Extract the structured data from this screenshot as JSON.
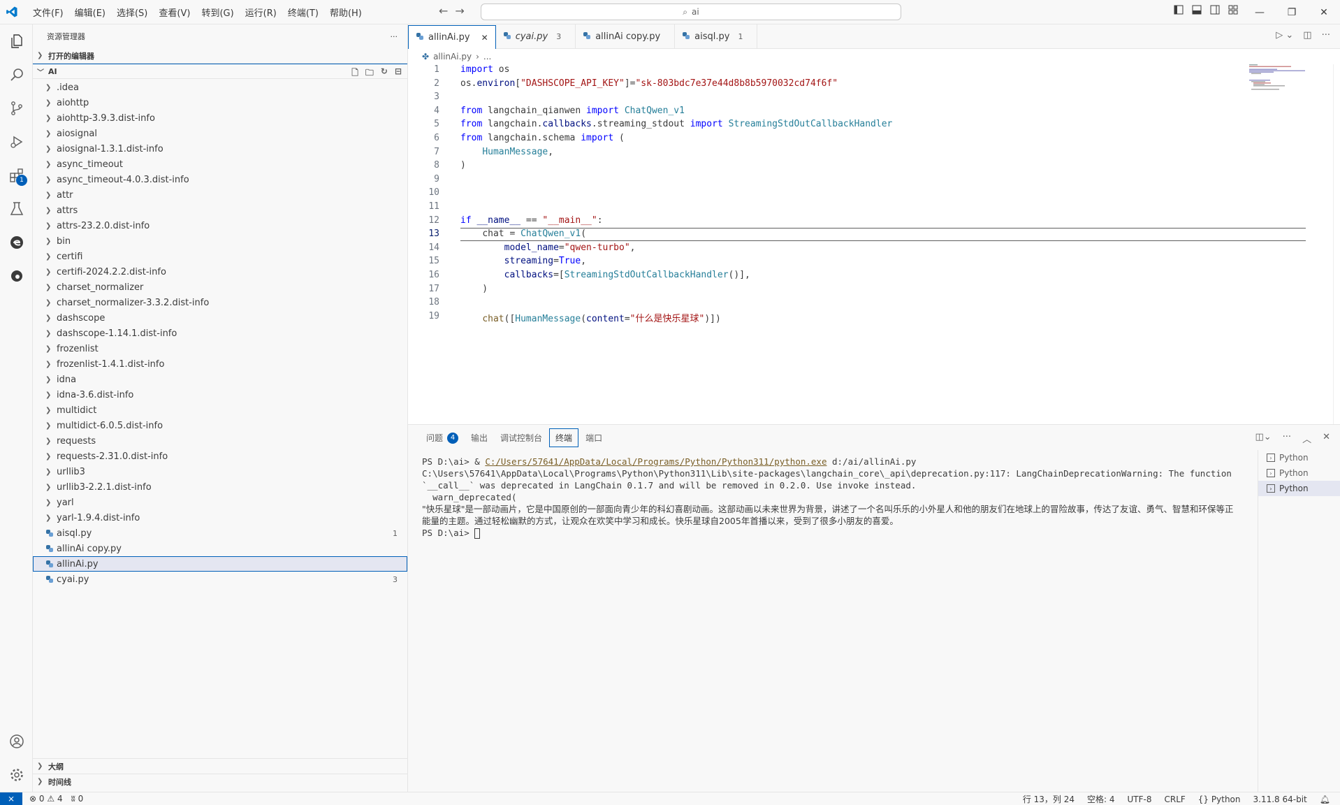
{
  "titlebar": {
    "menu": [
      "文件(F)",
      "编辑(E)",
      "选择(S)",
      "查看(V)",
      "转到(G)",
      "运行(R)",
      "终端(T)",
      "帮助(H)"
    ],
    "search_text": "ai",
    "accent": "#005fb8"
  },
  "sidebar": {
    "header": "资源管理器",
    "more": "···",
    "open_editors": "打开的编辑器",
    "folder": "AI",
    "items": [
      {
        "label": ".idea",
        "type": "folder"
      },
      {
        "label": "aiohttp",
        "type": "folder"
      },
      {
        "label": "aiohttp-3.9.3.dist-info",
        "type": "folder"
      },
      {
        "label": "aiosignal",
        "type": "folder"
      },
      {
        "label": "aiosignal-1.3.1.dist-info",
        "type": "folder"
      },
      {
        "label": "async_timeout",
        "type": "folder"
      },
      {
        "label": "async_timeout-4.0.3.dist-info",
        "type": "folder"
      },
      {
        "label": "attr",
        "type": "folder"
      },
      {
        "label": "attrs",
        "type": "folder"
      },
      {
        "label": "attrs-23.2.0.dist-info",
        "type": "folder"
      },
      {
        "label": "bin",
        "type": "folder"
      },
      {
        "label": "certifi",
        "type": "folder"
      },
      {
        "label": "certifi-2024.2.2.dist-info",
        "type": "folder"
      },
      {
        "label": "charset_normalizer",
        "type": "folder"
      },
      {
        "label": "charset_normalizer-3.3.2.dist-info",
        "type": "folder"
      },
      {
        "label": "dashscope",
        "type": "folder"
      },
      {
        "label": "dashscope-1.14.1.dist-info",
        "type": "folder"
      },
      {
        "label": "frozenlist",
        "type": "folder"
      },
      {
        "label": "frozenlist-1.4.1.dist-info",
        "type": "folder"
      },
      {
        "label": "idna",
        "type": "folder"
      },
      {
        "label": "idna-3.6.dist-info",
        "type": "folder"
      },
      {
        "label": "multidict",
        "type": "folder"
      },
      {
        "label": "multidict-6.0.5.dist-info",
        "type": "folder"
      },
      {
        "label": "requests",
        "type": "folder"
      },
      {
        "label": "requests-2.31.0.dist-info",
        "type": "folder"
      },
      {
        "label": "urllib3",
        "type": "folder"
      },
      {
        "label": "urllib3-2.2.1.dist-info",
        "type": "folder"
      },
      {
        "label": "yarl",
        "type": "folder"
      },
      {
        "label": "yarl-1.9.4.dist-info",
        "type": "folder"
      },
      {
        "label": "aisql.py",
        "type": "file",
        "count": "1"
      },
      {
        "label": "allinAi copy.py",
        "type": "file",
        "count": ""
      },
      {
        "label": "allinAi.py",
        "type": "file",
        "count": "",
        "selected": true
      },
      {
        "label": "cyai.py",
        "type": "file",
        "count": "3"
      }
    ],
    "outline": "大纲",
    "timeline": "时间线"
  },
  "tabs": [
    {
      "label": "allinAi.py",
      "num": "",
      "active": true,
      "italic": false
    },
    {
      "label": "cyai.py",
      "num": "3",
      "active": false,
      "italic": true
    },
    {
      "label": "allinAi copy.py",
      "num": "",
      "active": false,
      "italic": false
    },
    {
      "label": "aisql.py",
      "num": "1",
      "active": false,
      "italic": false
    }
  ],
  "breadcrumb": {
    "file": "allinAi.py",
    "rest": "..."
  },
  "code": {
    "lines": [
      "import os",
      "os.environ[\"DASHSCOPE_API_KEY\"]=\"sk-803bdc7e37e44d8b8b5970032cd74f6f\"",
      "",
      "from langchain_qianwen import ChatQwen_v1",
      "from langchain.callbacks.streaming_stdout import StreamingStdOutCallbackHandler",
      "from langchain.schema import (",
      "    HumanMessage,",
      ")",
      "",
      "",
      "",
      "if __name__ == \"__main__\":",
      "    chat = ChatQwen_v1(",
      "        model_name=\"qwen-turbo\",",
      "        streaming=True,",
      "        callbacks=[StreamingStdOutCallbackHandler()],",
      "    )",
      "",
      "    chat([HumanMessage(content=\"什么是快乐星球\")])"
    ],
    "current_line": 13
  },
  "panel": {
    "tabs": [
      {
        "label": "问题",
        "badge": "4",
        "active": false
      },
      {
        "label": "输出",
        "badge": "",
        "active": false
      },
      {
        "label": "调试控制台",
        "badge": "",
        "active": false
      },
      {
        "label": "终端",
        "badge": "",
        "active": true
      },
      {
        "label": "端口",
        "badge": "",
        "active": false
      }
    ],
    "terminal": {
      "prompt1": "PS D:\\ai> & ",
      "exe_path": "C:/Users/57641/AppData/Local/Programs/Python/Python311/python.exe",
      "script": " d:/ai/allinAi.py",
      "warning": "C:\\Users\\57641\\AppData\\Local\\Programs\\Python\\Python311\\Lib\\site-packages\\langchain_core\\_api\\deprecation.py:117: LangChainDeprecationWarning: The function `__call__` was deprecated in LangChain 0.1.7 and will be removed in 0.2.0. Use invoke instead.",
      "warn_call": "  warn_deprecated(",
      "answer": "\"快乐星球\"是一部动画片，它是中国原创的一部面向青少年的科幻喜剧动画。这部动画以未来世界为背景，讲述了一个名叫乐乐的小外星人和他的朋友们在地球上的冒险故事，传达了友谊、勇气、智慧和环保等正能量的主题。通过轻松幽默的方式，让观众在欢笑中学习和成长。快乐星球自2005年首播以来，受到了很多小朋友的喜爱。",
      "prompt2": "PS D:\\ai> "
    },
    "terminal_list": [
      "Python",
      "Python",
      "Python"
    ]
  },
  "statusbar": {
    "errors": "0",
    "warnings": "4",
    "ports": "0",
    "position": "行 13，列 24",
    "spaces": "空格: 4",
    "encoding": "UTF-8",
    "eol": "CRLF",
    "language": "Python",
    "interpreter": "3.11.8 64-bit"
  }
}
